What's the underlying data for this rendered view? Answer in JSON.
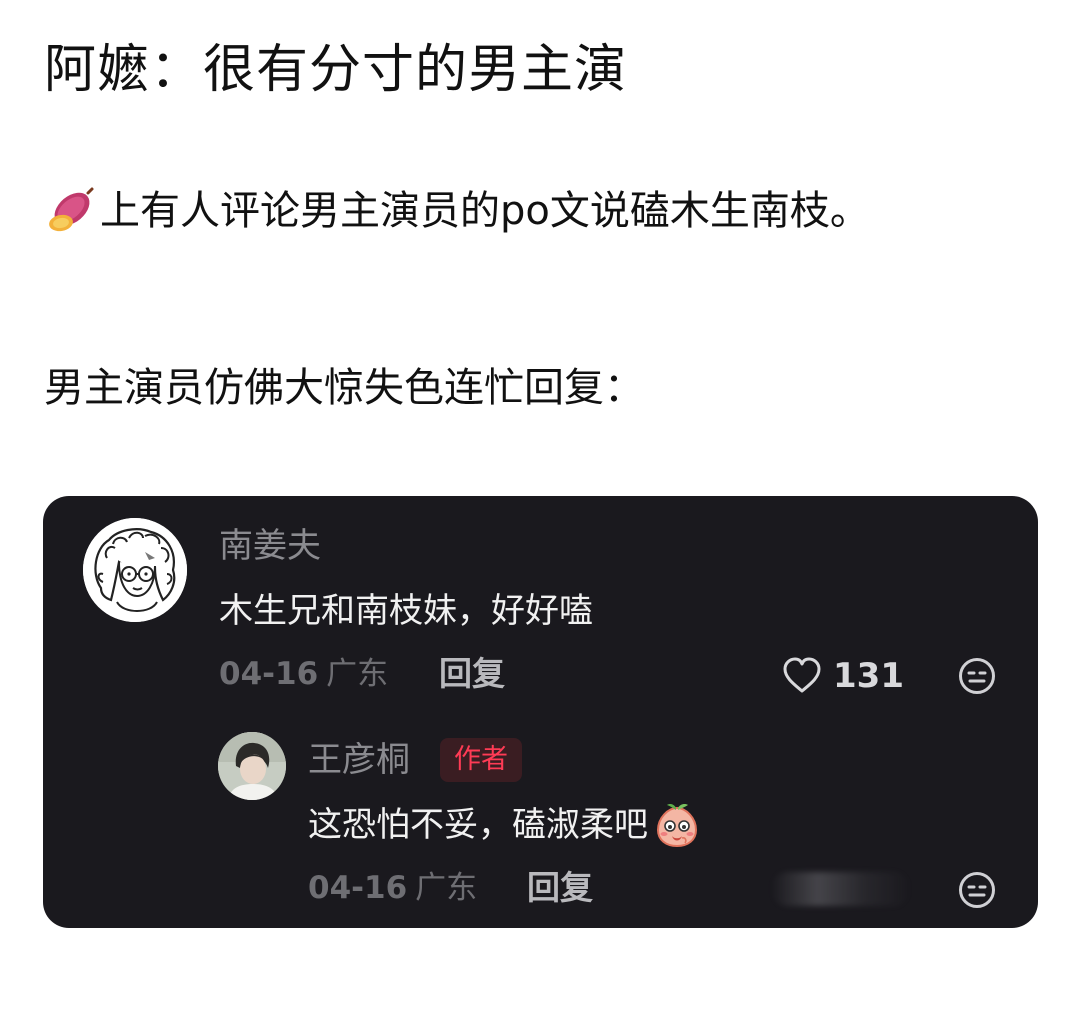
{
  "post": {
    "title": "阿嬷：很有分寸的男主演",
    "paragraph_1": "上有人评论男主演员的po文说磕木生南枝。",
    "paragraph_1_icon": "sweet-potato-icon",
    "paragraph_2": "男主演员仿佛大惊失色连忙回复："
  },
  "comment": {
    "username": "南姜夫",
    "text": "木生兄和南枝妹，好好嗑",
    "date": "04-16",
    "location": "广东",
    "reply_label": "回复",
    "like_count": "131",
    "avatar_icon": "curly-hair-glasses-avatar"
  },
  "reply": {
    "username": "王彦桐",
    "badge": "作者",
    "text": "这恐怕不妥，磕淑柔吧",
    "emoji_icon": "peach-blush-emoji",
    "date": "04-16",
    "location": "广东",
    "reply_label": "回复",
    "avatar_icon": "profile-photo-avatar"
  },
  "colors": {
    "card_background": "#1a191e",
    "author_badge_text": "#ff3b55",
    "muted_text": "#6e6e73"
  }
}
